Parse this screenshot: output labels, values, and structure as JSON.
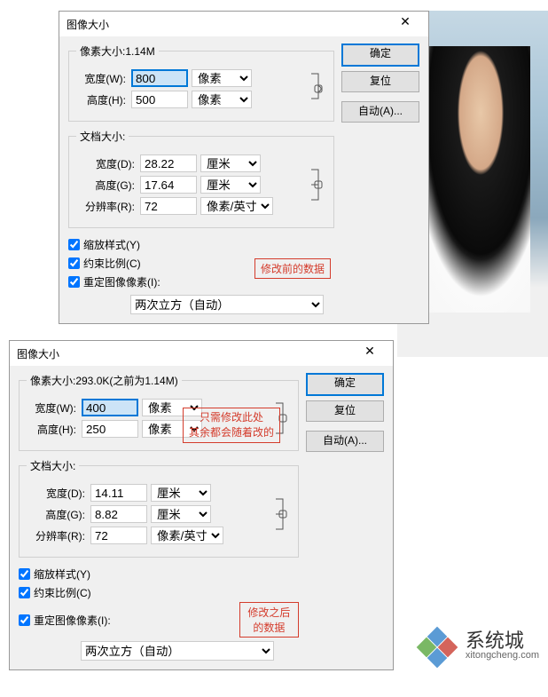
{
  "d1": {
    "title": "图像大小",
    "pixelLegend": "像素大小:1.14M",
    "widthLabel": "宽度(W):",
    "widthVal": "800",
    "heightLabel": "高度(H):",
    "heightVal": "500",
    "pxUnit": "像素",
    "docLegend": "文档大小:",
    "docWidthLabel": "宽度(D):",
    "docWidthVal": "28.22",
    "docHeightLabel": "高度(G):",
    "docHeightVal": "17.64",
    "cmUnit": "厘米",
    "resLabel": "分辨率(R):",
    "resVal": "72",
    "resUnit": "像素/英寸",
    "scale": "缩放样式(Y)",
    "constrain": "约束比例(C)",
    "resample": "重定图像像素(I):",
    "method": "两次立方（自动）",
    "ok": "确定",
    "reset": "复位",
    "auto": "自动(A)..."
  },
  "d2": {
    "title": "图像大小",
    "pixelLegend": "像素大小:293.0K(之前为1.14M)",
    "widthLabel": "宽度(W):",
    "widthVal": "400",
    "heightLabel": "高度(H):",
    "heightVal": "250",
    "pxUnit": "像素",
    "docLegend": "文档大小:",
    "docWidthLabel": "宽度(D):",
    "docWidthVal": "14.11",
    "docHeightLabel": "高度(G):",
    "docHeightVal": "8.82",
    "cmUnit": "厘米",
    "resLabel": "分辨率(R):",
    "resVal": "72",
    "resUnit": "像素/英寸",
    "scale": "缩放样式(Y)",
    "constrain": "约束比例(C)",
    "resample": "重定图像像素(I):",
    "method": "两次立方（自动）",
    "ok": "确定",
    "reset": "复位",
    "auto": "自动(A)..."
  },
  "annot": {
    "before": "修改前的数据",
    "onlyL1": "只需修改此处",
    "onlyL2": "其余都会随着改的",
    "after": "修改之后的数据"
  },
  "logo": {
    "name": "系统城",
    "url": "xitongcheng.com"
  }
}
